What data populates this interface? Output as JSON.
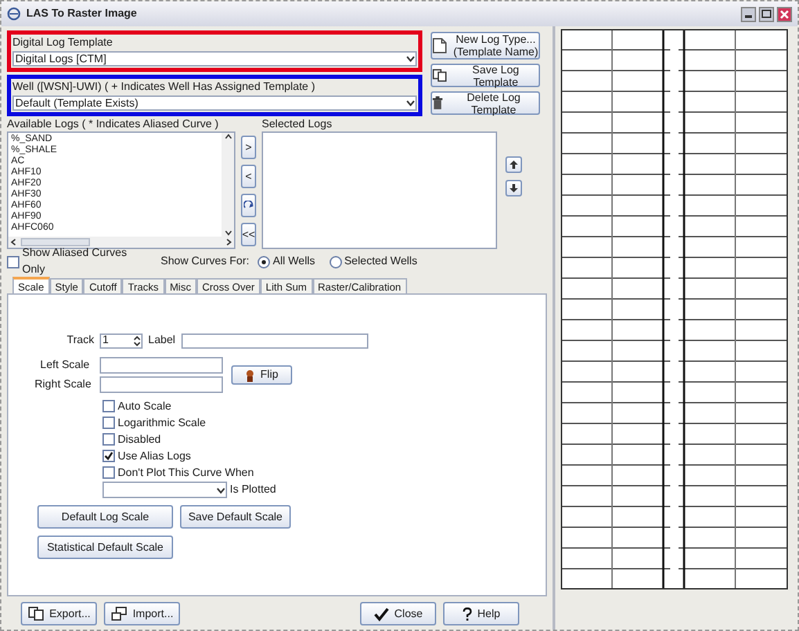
{
  "window": {
    "title": "LAS To Raster Image"
  },
  "template_group": {
    "label": "Digital Log Template",
    "value": "Digital Logs [CTM]"
  },
  "well_group": {
    "label": "Well ([WSN]-UWI) ( + Indicates Well Has Assigned Template )",
    "value": "Default (Template Exists)"
  },
  "template_buttons": [
    {
      "label": "New Log Type...",
      "sublabel": "(Template Name)",
      "kind": "new"
    },
    {
      "label": "Save Log Template",
      "kind": "save"
    },
    {
      "label": "Delete Log Template",
      "kind": "delete"
    }
  ],
  "available_logs": {
    "label": "Available Logs ( * Indicates Aliased Curve )",
    "items": [
      "%_SAND",
      "%_SHALE",
      "AC",
      "AHF10",
      "AHF20",
      "AHF30",
      "AHF60",
      "AHF90",
      "AHFC060"
    ]
  },
  "transfer_buttons": [
    {
      "kind": "text",
      "label": ">"
    },
    {
      "kind": "text",
      "label": "<"
    },
    {
      "kind": "icon"
    },
    {
      "kind": "text",
      "label": "<<"
    }
  ],
  "selected_logs": {
    "label": "Selected Logs"
  },
  "show_aliased": {
    "label": "Show Aliased Curves Only",
    "checked": false
  },
  "show_curves_for": {
    "label": "Show Curves For:",
    "options": [
      {
        "label": "All Wells",
        "selected": true
      },
      {
        "label": "Selected Wells",
        "selected": false
      }
    ]
  },
  "tabs": [
    {
      "label": "Scale",
      "selected": true
    },
    {
      "label": "Style",
      "selected": false
    },
    {
      "label": "Cutoff",
      "selected": false
    },
    {
      "label": "Tracks",
      "selected": false
    },
    {
      "label": "Misc",
      "selected": false
    },
    {
      "label": "Cross Over",
      "selected": false
    },
    {
      "label": "Lith Sum",
      "selected": false
    },
    {
      "label": "Raster/Calibration",
      "selected": false
    }
  ],
  "scale": {
    "track_label": "Track",
    "track_value": "1",
    "label_label": "Label",
    "left_scale_label": "Left Scale",
    "right_scale_label": "Right Scale",
    "flip_button": "Flip",
    "checkboxes": [
      {
        "label": "Auto Scale",
        "checked": false
      },
      {
        "label": "Logarithmic Scale",
        "checked": false
      },
      {
        "label": "Disabled",
        "checked": false
      },
      {
        "label": "Use Alias Logs",
        "checked": true
      },
      {
        "label": "Don't Plot This Curve When",
        "checked": false
      }
    ],
    "plotted_suffix": "Is Plotted",
    "buttons": [
      "Default Log Scale",
      "Save Default Scale",
      "Statistical Default Scale"
    ]
  },
  "bottom_buttons": [
    {
      "label": "Export...",
      "kind": "export"
    },
    {
      "label": "Import...",
      "kind": "import"
    },
    {
      "label": "Close",
      "kind": "close"
    },
    {
      "label": "Help",
      "kind": "help"
    }
  ]
}
